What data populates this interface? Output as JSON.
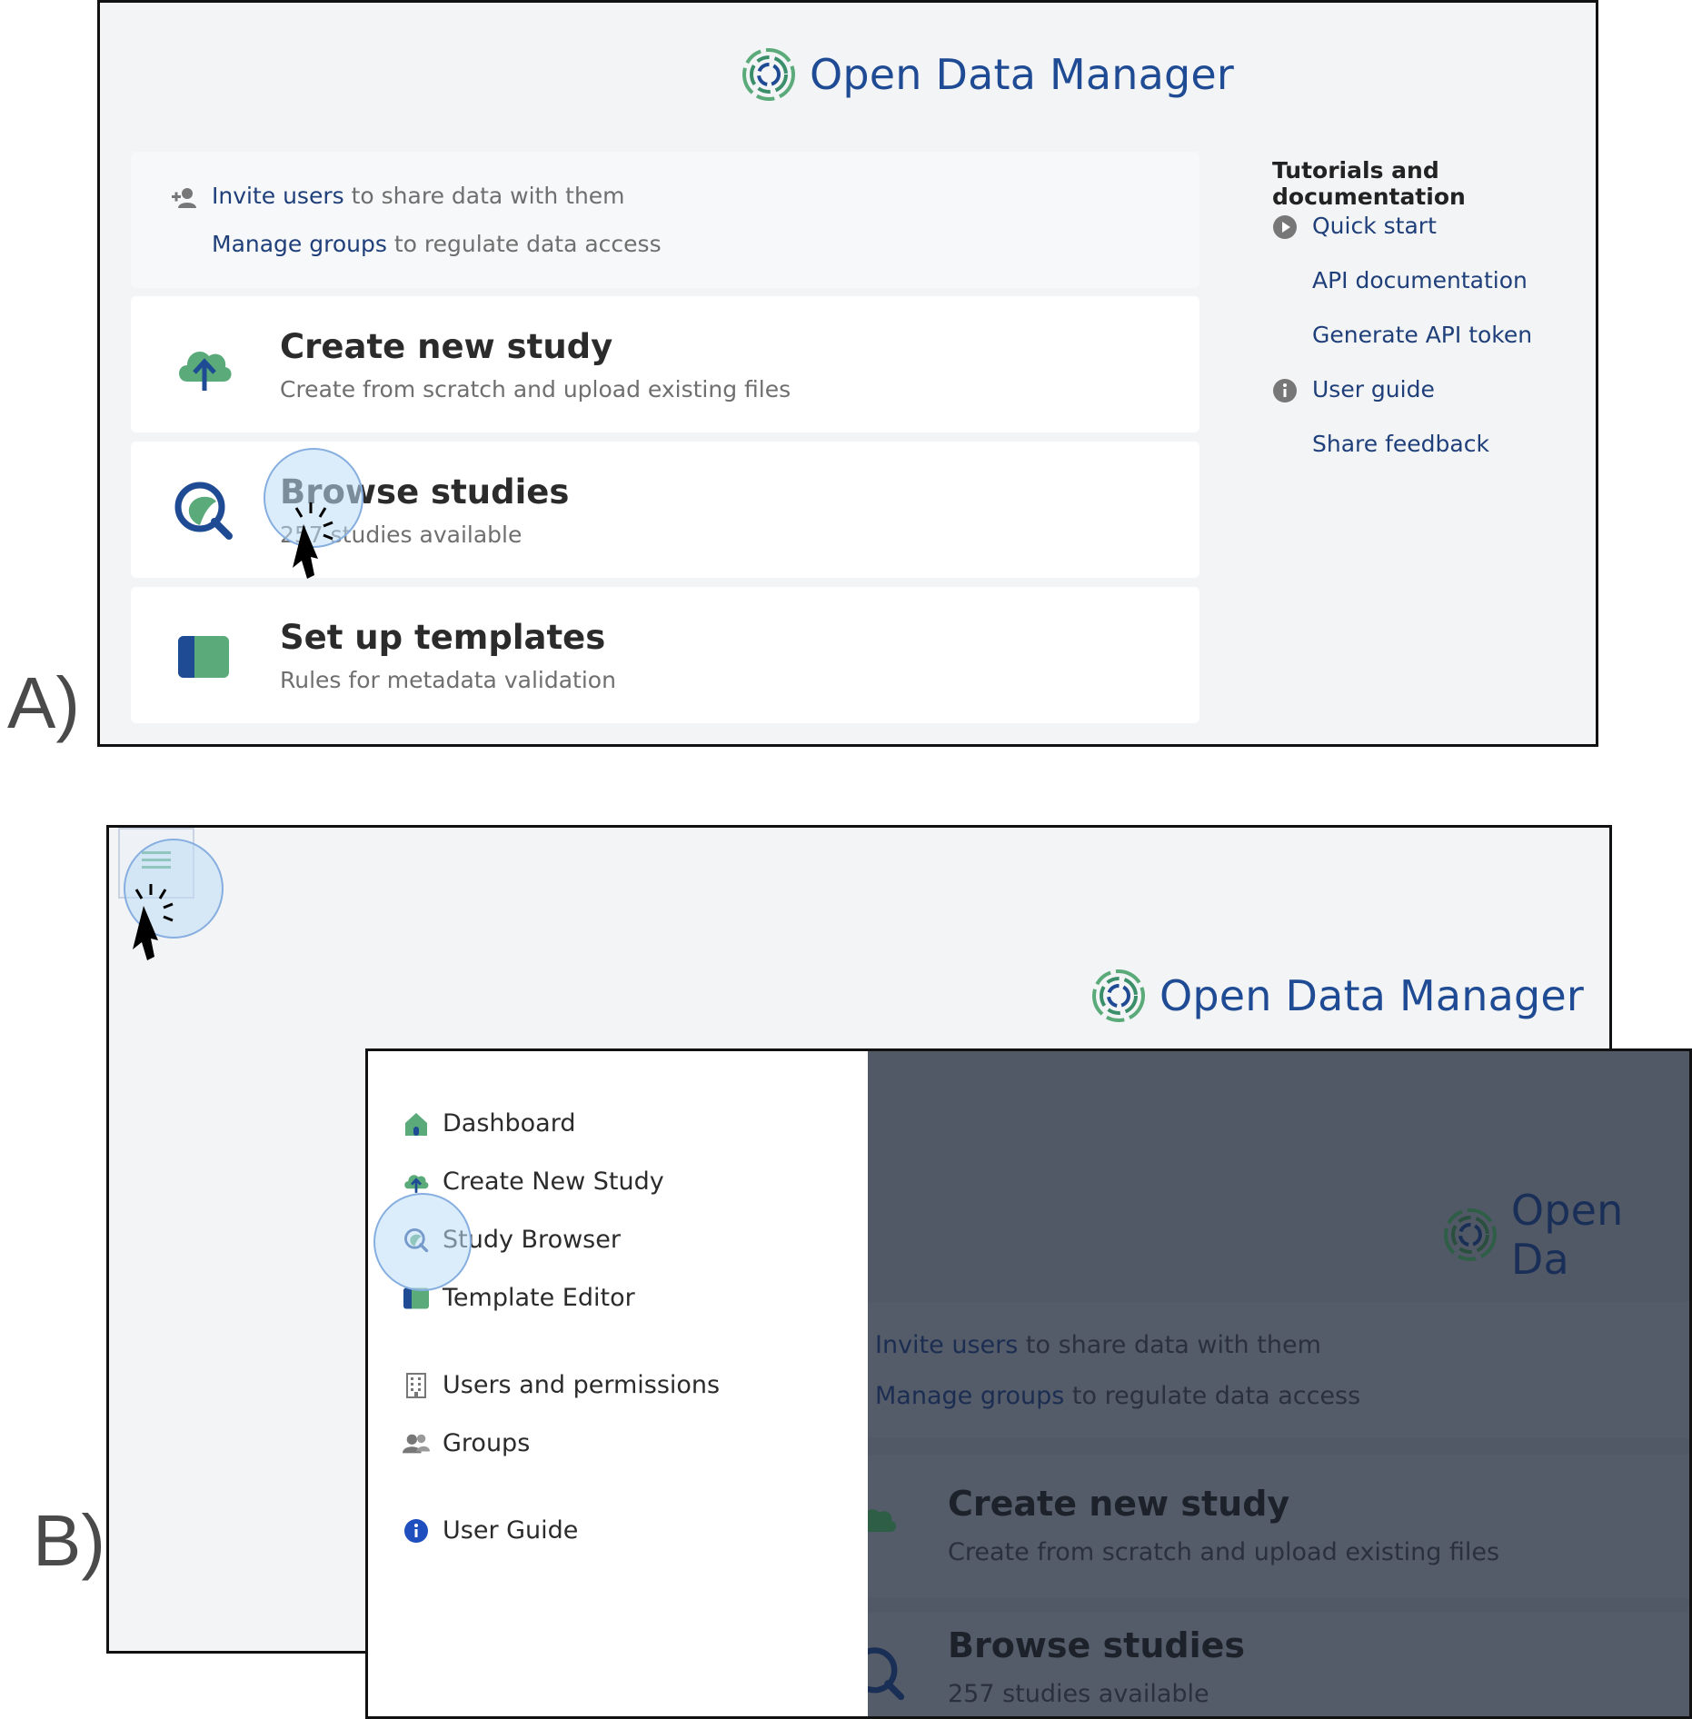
{
  "panel_a": {
    "label": "A)",
    "brand": "Open Data Manager",
    "info_card": {
      "invite_link": "Invite users",
      "invite_rest": " to share data with them",
      "groups_link": "Manage groups",
      "groups_rest": " to regulate data access"
    },
    "cards": [
      {
        "title": "Create new study",
        "subtitle": "Create from scratch and upload existing files",
        "icon": "cloud-upload-icon"
      },
      {
        "title": "Browse studies",
        "subtitle": "257 studies available",
        "icon": "search-icon"
      },
      {
        "title": "Set up templates",
        "subtitle": "Rules for metadata validation",
        "icon": "template-icon"
      }
    ],
    "sidebar": {
      "heading": "Tutorials and documentation",
      "links": [
        {
          "label": "Quick start",
          "icon": "play-icon"
        },
        {
          "label": "API documentation",
          "icon": ""
        },
        {
          "label": "Generate API token",
          "icon": ""
        },
        {
          "label": "User guide",
          "icon": "info-icon"
        },
        {
          "label": "Share feedback",
          "icon": ""
        }
      ]
    }
  },
  "panel_b": {
    "label": "B)",
    "brand": "Open Data Manager",
    "brand_overlay": "Open Da",
    "menu": [
      {
        "label": "Dashboard",
        "icon": "home-icon"
      },
      {
        "label": "Create New Study",
        "icon": "cloud-upload-icon"
      },
      {
        "label": "Study Browser",
        "icon": "search-icon"
      },
      {
        "label": "Template Editor",
        "icon": "template-icon"
      },
      {
        "label": "Users and permissions",
        "icon": "building-icon"
      },
      {
        "label": "Groups",
        "icon": "users-icon"
      },
      {
        "label": "User Guide",
        "icon": "info-icon"
      }
    ],
    "background": {
      "invite_link": "Invite users",
      "invite_rest": " to share data with them",
      "groups_link": "Manage groups",
      "groups_rest": " to regulate data access",
      "card1_title": "Create new study",
      "card1_sub": "Create from scratch and upload existing files",
      "card2_title": "Browse studies",
      "card2_sub": "257 studies available"
    }
  },
  "colors": {
    "brand_blue": "#1f4b94",
    "brand_green": "#5aaa7a",
    "overlay": "#515866",
    "click_highlight": "#cfe4f7"
  }
}
